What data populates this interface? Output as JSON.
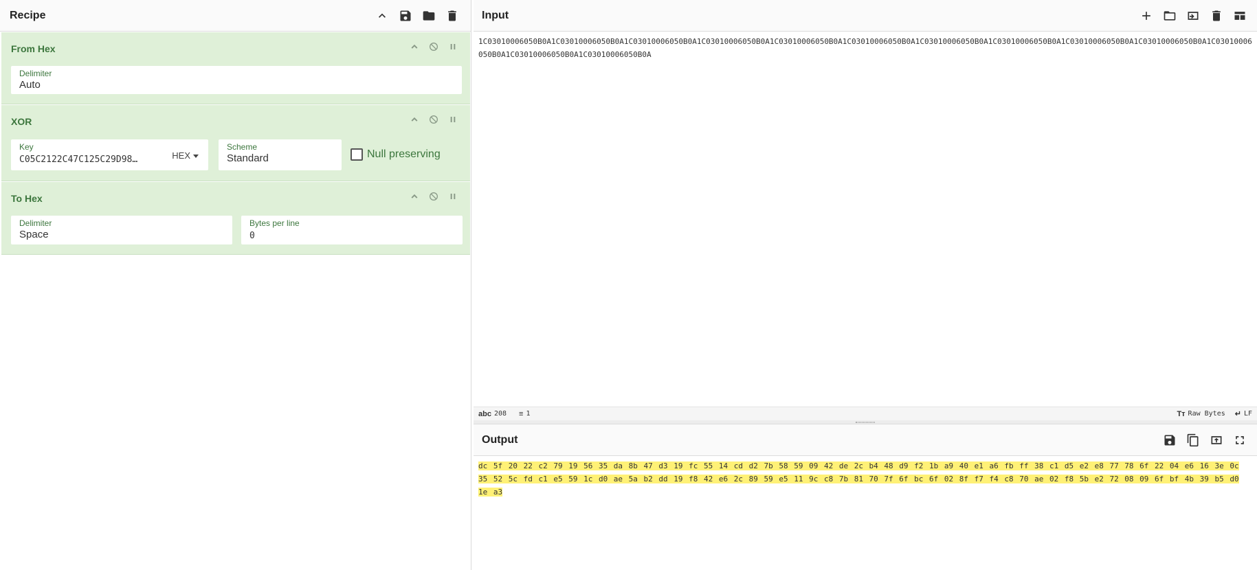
{
  "recipe": {
    "title": "Recipe",
    "operations": [
      {
        "name": "From Hex",
        "delimiter_label": "Delimiter",
        "delimiter_value": "Auto"
      },
      {
        "name": "XOR",
        "key_label": "Key",
        "key_value": "C05C2122C47C125C29D98…",
        "key_format": "HEX",
        "scheme_label": "Scheme",
        "scheme_value": "Standard",
        "null_preserving_label": "Null preserving"
      },
      {
        "name": "To Hex",
        "delimiter_label": "Delimiter",
        "delimiter_value": "Space",
        "bytes_label": "Bytes per line",
        "bytes_value": "0"
      }
    ]
  },
  "input": {
    "title": "Input",
    "text": "1C03010006050B0A1C03010006050B0A1C03010006050B0A1C03010006050B0A1C03010006050B0A1C03010006050B0A1C03010006050B0A1C03010006050B0A1C03010006050B0A1C03010006050B0A1C03010006050B0A1C03010006050B0A1C03010006050B0A",
    "status": {
      "length_icon": "abc",
      "length": "208",
      "lines": "1",
      "encoding": "Raw Bytes",
      "eol": "LF"
    }
  },
  "output": {
    "title": "Output",
    "text": "dc 5f 20 22 c2 79 19 56 35 da 8b 47 d3 19 fc 55 14 cd d2 7b 58 59 09 42 de 2c b4 48 d9 f2 1b a9 40 e1 a6 fb ff 38 c1 d5 e2 e8 77 78 6f 22 04 e6 16 3e 0c 35 52 5c fd c1 e5 59 1c d0 ae 5a b2 dd 19 f8 42 e6 2c 89 59 e5 11 9c c8 7b 81 70 7f 6f bc 6f 02 8f f7 f4 c8 70 ae 02 f8 5b e2 72 08 09 6f bf 4b 39 b5 d0 1e a3"
  }
}
